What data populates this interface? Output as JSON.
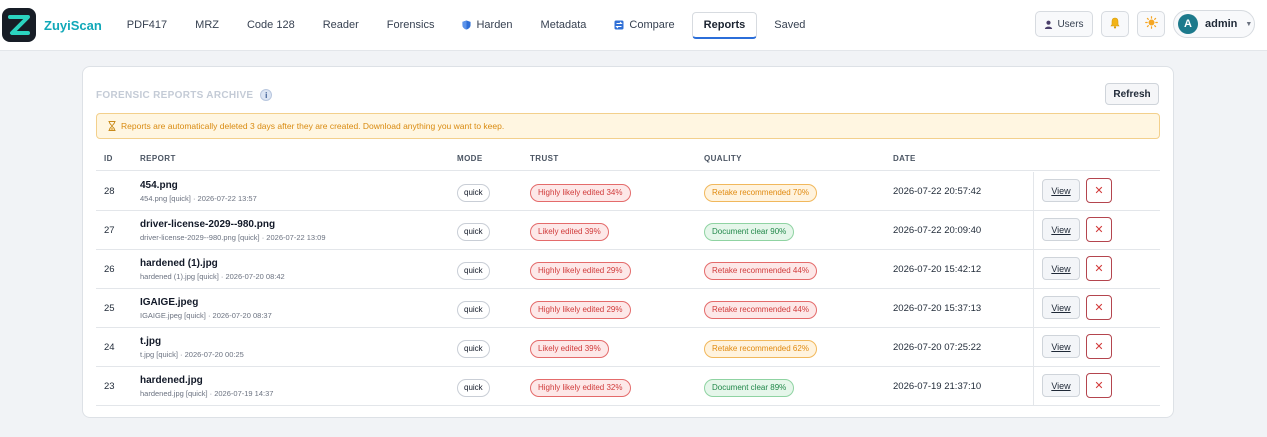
{
  "app": {
    "brand": "ZuyiScan",
    "nav": [
      {
        "label": "PDF417",
        "icon": ""
      },
      {
        "label": "MRZ",
        "icon": ""
      },
      {
        "label": "Code 128",
        "icon": ""
      },
      {
        "label": "Reader",
        "icon": ""
      },
      {
        "label": "Forensics",
        "icon": ""
      },
      {
        "label": "Harden",
        "icon": "shield-icon"
      },
      {
        "label": "Metadata",
        "icon": ""
      },
      {
        "label": "Compare",
        "icon": "compare-icon"
      },
      {
        "label": "Reports",
        "icon": "",
        "active": true
      },
      {
        "label": "Saved",
        "icon": ""
      }
    ],
    "users_label": "Users",
    "user": {
      "initial": "A",
      "name": "admin"
    }
  },
  "archive": {
    "title": "FORENSIC REPORTS ARCHIVE",
    "refresh_label": "Refresh",
    "notice": "Reports are automatically deleted 3 days after they are created. Download anything you want to keep.",
    "columns": {
      "id": "ID",
      "report": "REPORT",
      "mode": "MODE",
      "trust": "TRUST",
      "quality": "QUALITY",
      "date": "DATE"
    },
    "view_label": "View",
    "delete_label": "✕",
    "rows": [
      {
        "id": "28",
        "name": "454.png",
        "meta": "454.png [quick] · 2026-07-22 13:57",
        "mode": "quick",
        "trust": "Highly likely edited 34%",
        "trust_level": "red",
        "quality": "Retake recommended 70%",
        "quality_level": "orange",
        "date": "2026-07-22 20:57:42"
      },
      {
        "id": "27",
        "name": "driver-license-2029--980.png",
        "meta": "driver-license-2029--980.png [quick] · 2026-07-22 13:09",
        "mode": "quick",
        "trust": "Likely edited 39%",
        "trust_level": "red",
        "quality": "Document clear 90%",
        "quality_level": "green",
        "date": "2026-07-22 20:09:40"
      },
      {
        "id": "26",
        "name": "hardened (1).jpg",
        "meta": "hardened (1).jpg [quick] · 2026-07-20 08:42",
        "mode": "quick",
        "trust": "Highly likely edited 29%",
        "trust_level": "red",
        "quality": "Retake recommended 44%",
        "quality_level": "red",
        "date": "2026-07-20 15:42:12"
      },
      {
        "id": "25",
        "name": "IGAIGE.jpeg",
        "meta": "IGAIGE.jpeg [quick] · 2026-07-20 08:37",
        "mode": "quick",
        "trust": "Highly likely edited 29%",
        "trust_level": "red",
        "quality": "Retake recommended 44%",
        "quality_level": "red",
        "date": "2026-07-20 15:37:13"
      },
      {
        "id": "24",
        "name": "t.jpg",
        "meta": "t.jpg [quick] · 2026-07-20 00:25",
        "mode": "quick",
        "trust": "Likely edited 39%",
        "trust_level": "red",
        "quality": "Retake recommended 62%",
        "quality_level": "orange",
        "date": "2026-07-20 07:25:22"
      },
      {
        "id": "23",
        "name": "hardened.jpg",
        "meta": "hardened.jpg [quick] · 2026-07-19 14:37",
        "mode": "quick",
        "trust": "Highly likely edited 32%",
        "trust_level": "red",
        "quality": "Document clear 89%",
        "quality_level": "green",
        "date": "2026-07-19 21:37:10"
      }
    ]
  }
}
